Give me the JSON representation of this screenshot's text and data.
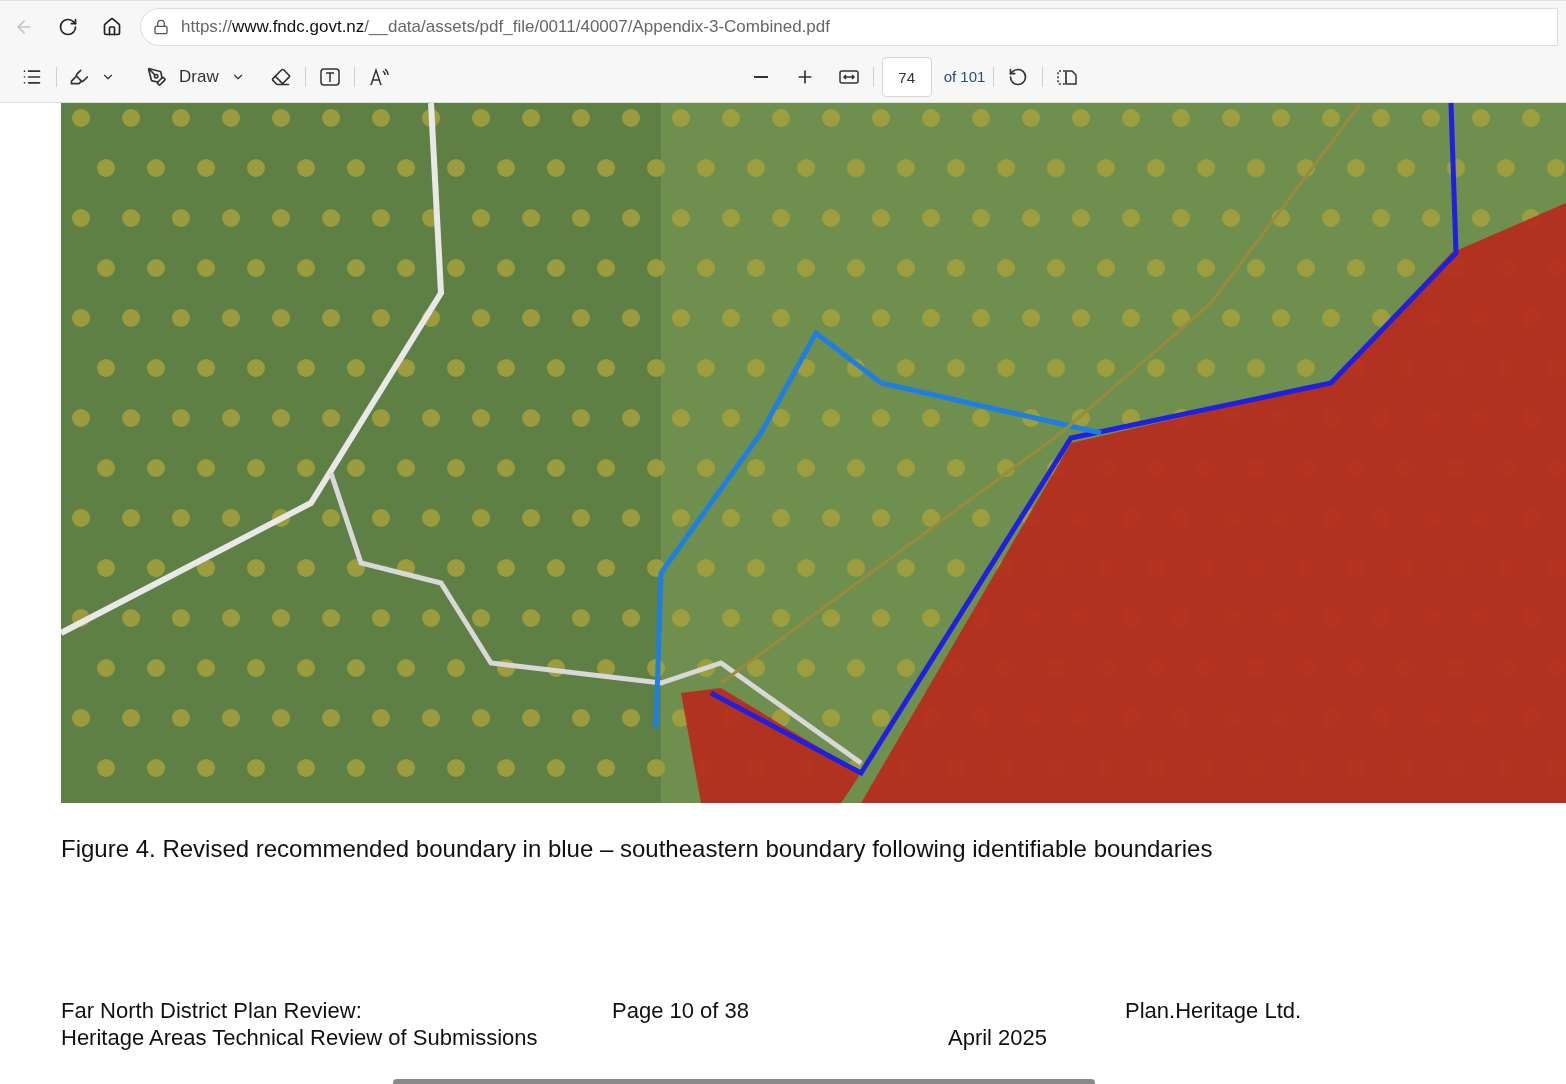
{
  "browser": {
    "back": {
      "disabled": true
    },
    "address": {
      "scheme": "https://",
      "host": "www.fndc.govt.nz",
      "path": "/__data/assets/pdf_file/0011/40007/Appendix-3-Combined.pdf"
    }
  },
  "pdf_toolbar": {
    "draw_label": "Draw",
    "page_number": "74",
    "page_total": "of 101"
  },
  "page": {
    "caption": "Figure 4. Revised recommended boundary in blue – southeastern boundary following identifiable boundaries",
    "footer": {
      "left_line_1": "Far North District Plan Review:",
      "left_line_2": "Heritage Areas Technical Review of Submissions",
      "center": "Page 10 of 38",
      "date": "April 2025",
      "right": "Plan.Heritage Ltd."
    }
  }
}
